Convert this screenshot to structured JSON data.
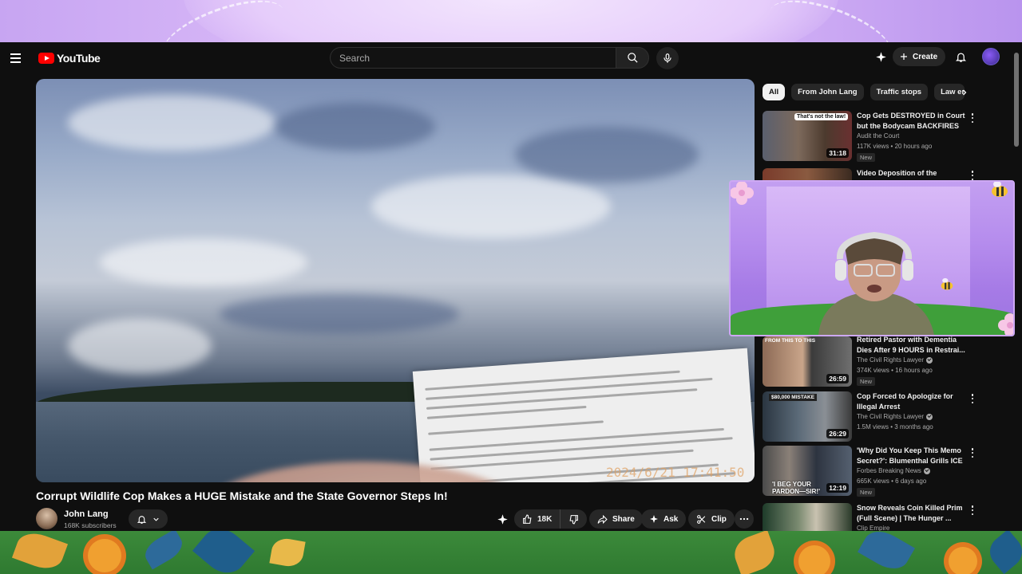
{
  "masthead": {
    "logo_text": "YouTube",
    "search_placeholder": "Search",
    "create_label": "Create"
  },
  "video": {
    "title": "Corrupt Wildlife Cop Makes a HUGE Mistake and the State Governor Steps In!",
    "overlay_timestamp": "2024/6/21  17:41:50"
  },
  "channel": {
    "name": "John Lang",
    "subscribers": "168K subscribers"
  },
  "actions": {
    "likes": "18K",
    "share": "Share",
    "ask": "Ask",
    "clip": "Clip"
  },
  "chips": [
    "All",
    "From John Lang",
    "Traffic stops",
    "Law enforcement"
  ],
  "recommendations": [
    {
      "title": "Cop Gets DESTROYED in Court but the Bodycam BACKFIRES",
      "channel": "Audit the Court",
      "verified": false,
      "meta": "117K views • 20 hours ago",
      "badge": "New",
      "duration": "31:18",
      "thumb_text": "That's not the law!"
    },
    {
      "title": "Video Deposition of the",
      "channel": "",
      "verified": false,
      "meta": "",
      "badge": "",
      "duration": "",
      "thumb_text": ""
    },
    {
      "title": "Retired Pastor with Dementia Dies After 9 HOURS in Restrai...",
      "channel": "The Civil Rights Lawyer",
      "verified": true,
      "meta": "374K views • 16 hours ago",
      "badge": "New",
      "duration": "26:59",
      "thumb_text": "FROM THIS    TO THIS"
    },
    {
      "title": "Cop Forced to Apologize for Illegal Arrest",
      "channel": "The Civil Rights Lawyer",
      "verified": true,
      "meta": "1.5M views • 3 months ago",
      "badge": "",
      "duration": "26:29",
      "thumb_text": "$80,000 MISTAKE"
    },
    {
      "title": "'Why Did You Keep This Memo Secret?': Blumenthal Grills ICE ...",
      "channel": "Forbes Breaking News",
      "verified": true,
      "meta": "665K views • 6 days ago",
      "badge": "New",
      "duration": "12:19",
      "thumb_text": "'I BEG YOUR PARDON—SIR!'"
    },
    {
      "title": "Snow Reveals Coin Killed Prim (Full Scene) | The Hunger ...",
      "channel": "Clip Empire",
      "verified": false,
      "meta": "",
      "badge": "",
      "duration": "",
      "thumb_text": ""
    }
  ],
  "colors": {
    "background": "#0f0f0f",
    "brand_red": "#ff0000",
    "chip_bg": "#272727",
    "banner_purple": "#d9b9f7",
    "banner_green": "#3c8a3a"
  }
}
